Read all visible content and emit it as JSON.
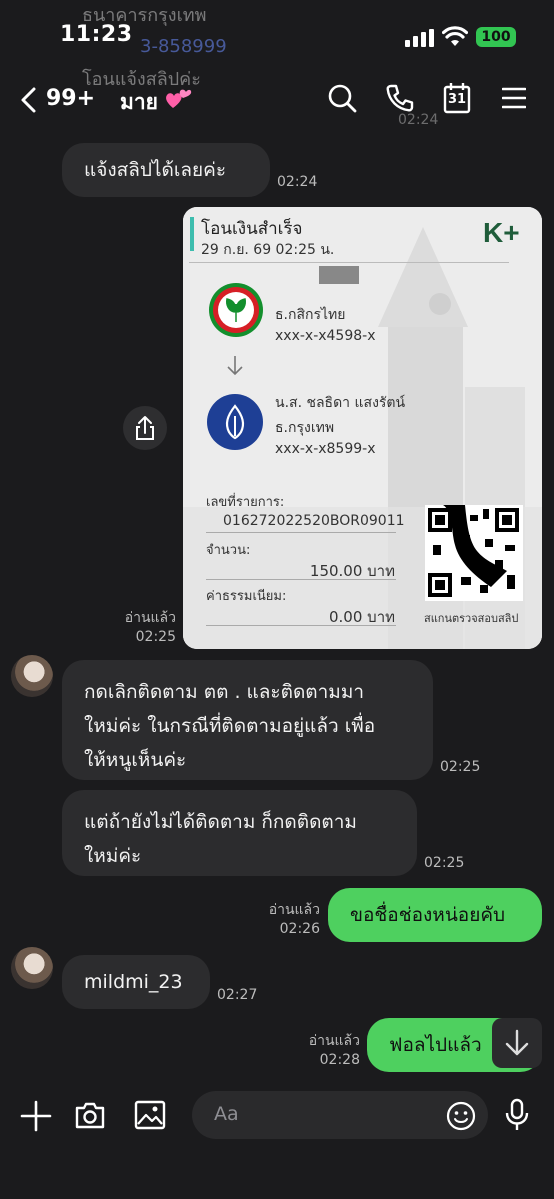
{
  "status_bar": {
    "time": "11:23",
    "battery": "100"
  },
  "header": {
    "back_count": "99+",
    "chat_name": "มาย",
    "calendar_day": "31"
  },
  "underlay": {
    "line1": "ธนาคารกรุงเทพ",
    "line2": "3-858999",
    "line3": "โอนแจ้งสลิปค่ะ",
    "time": "02:24"
  },
  "messages": [
    {
      "id": "m1",
      "text": "แจ้งสลิปได้เลยค่ะ",
      "time": "02:24"
    },
    {
      "id": "slip",
      "read": "อ่านแล้ว",
      "time": "02:25"
    },
    {
      "id": "m3",
      "lines": [
        "กดเลิกติดตาม ตต . และติดตามมา",
        "ใหม่ค่ะ ในกรณีที่ติดตามอยู่แล้ว เพื่อ",
        "ให้หนูเห็นค่ะ"
      ],
      "time": "02:25"
    },
    {
      "id": "m4",
      "lines": [
        "แต่ถ้ายังไม่ได้ติดตาม ก็กดติดตาม",
        "ใหม่ค่ะ"
      ],
      "time": "02:25"
    },
    {
      "id": "m5",
      "text": "ขอชื่อช่องหน่อยคับ",
      "read": "อ่านแล้ว",
      "time": "02:26"
    },
    {
      "id": "m6",
      "text": "mildmi_23",
      "time": "02:27"
    },
    {
      "id": "m7",
      "text": "ฟอลไปแล้ว",
      "read": "อ่านแล้ว",
      "time": "02:28"
    }
  ],
  "slip": {
    "title": "โอนเงินสำเร็จ",
    "date": "29 ก.ย. 69  02:25 น.",
    "logo": "K+",
    "from_bank": "ธ.กสิกรไทย",
    "from_account": "xxx-x-x4598-x",
    "to_name": "น.ส. ชลธิดา แสงรัตน์",
    "to_bank": "ธ.กรุงเทพ",
    "to_account": "xxx-x-x8599-x",
    "ref_label": "เลขที่รายการ:",
    "ref_value": "016272022520BOR09011",
    "amount_label": "จำนวน:",
    "amount_value": "150.00 บาท",
    "fee_label": "ค่าธรรมเนียม:",
    "fee_value": "0.00 บาท",
    "qr_caption": "สแกนตรวจสอบสลิป"
  },
  "composer": {
    "placeholder": "Aa"
  },
  "colors": {
    "background": "#1b1b1d",
    "bubble_gray": "#2c2c2e",
    "bubble_green": "#4ed05f",
    "kbank": "#138f2d",
    "bbl": "#1e3f95"
  }
}
